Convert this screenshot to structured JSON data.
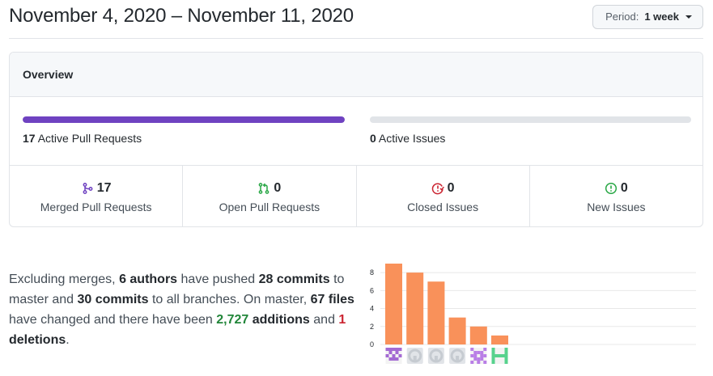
{
  "header": {
    "date_range": "November 4, 2020 – November 11, 2020",
    "period_label": "Period:",
    "period_value": "1 week"
  },
  "overview": {
    "title": "Overview",
    "active_pull_requests": {
      "count": "17",
      "label": "Active Pull Requests",
      "fill": 1.0,
      "color": "#6f42c1"
    },
    "active_issues": {
      "count": "0",
      "label": "Active Issues",
      "fill": 0.0,
      "color": "#2cbe4e"
    },
    "stats": [
      {
        "icon": "git-merge-icon",
        "count": "17",
        "label": "Merged Pull Requests",
        "color": "#6f42c1"
      },
      {
        "icon": "git-pull-request-icon",
        "count": "0",
        "label": "Open Pull Requests",
        "color": "#28a745"
      },
      {
        "icon": "issue-closed-icon",
        "count": "0",
        "label": "Closed Issues",
        "color": "#cb2431"
      },
      {
        "icon": "issue-opened-icon",
        "count": "0",
        "label": "New Issues",
        "color": "#28a745"
      }
    ]
  },
  "summary": {
    "p1": "Excluding merges, ",
    "authors": "6 authors",
    "p2": " have pushed ",
    "commits_master": "28 commits",
    "p3": " to master and ",
    "commits_all": "30 commits",
    "p4": " to all branches. On master, ",
    "files": "67 files",
    "p5": " have changed and there have been ",
    "additions_num": "2,727",
    "additions_word": " additions",
    "p6": " and ",
    "deletions_num": "1",
    "deletions_word": " deletions",
    "p7": "."
  },
  "chart_data": {
    "type": "bar",
    "categories": [
      "author-1",
      "author-2",
      "author-3",
      "author-4",
      "author-5",
      "author-6"
    ],
    "values": [
      9,
      8,
      7,
      3,
      2,
      1
    ],
    "yticks": [
      "0",
      "2",
      "4",
      "6",
      "8"
    ],
    "ylim": [
      0,
      9
    ],
    "grid": true,
    "bar_color": "#f9915a",
    "avatars": [
      {
        "type": "identicon",
        "color": "#a46ad3"
      },
      {
        "type": "github-default",
        "color": "#c6cbd1"
      },
      {
        "type": "github-default",
        "color": "#c6cbd1"
      },
      {
        "type": "github-default",
        "color": "#c6cbd1"
      },
      {
        "type": "identicon",
        "color": "#b97ee6"
      },
      {
        "type": "identicon",
        "color": "#57d28d"
      }
    ]
  }
}
